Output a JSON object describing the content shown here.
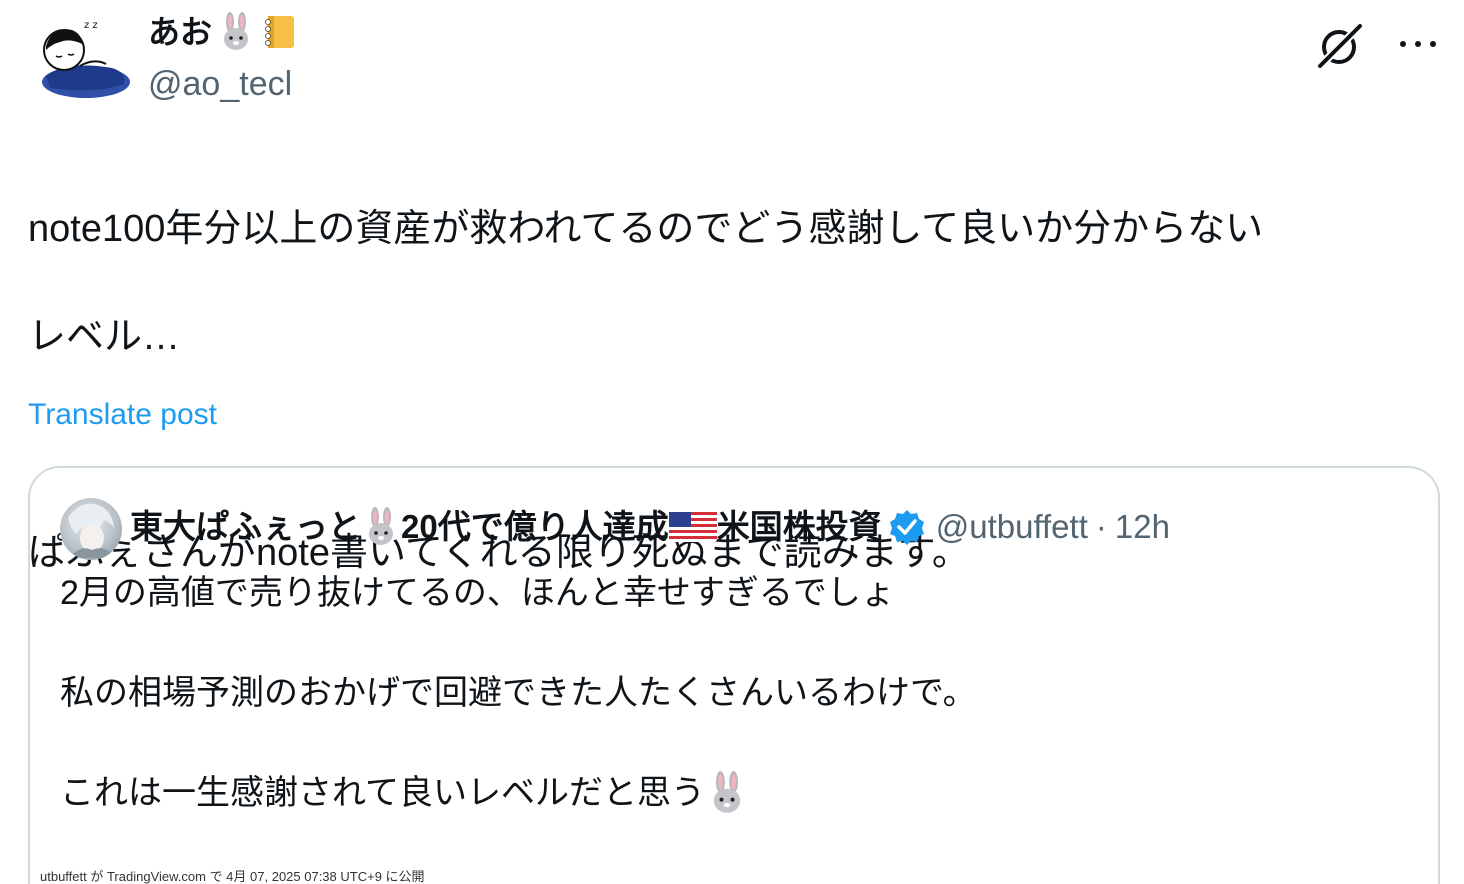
{
  "author": {
    "name": "あお",
    "name_emojis": [
      "rabbit-emoji",
      "notebook-emoji"
    ],
    "handle": "@ao_tecl"
  },
  "header_actions": {
    "grok_icon": "grok-slash-icon",
    "more_icon": "more-horizontal-icon"
  },
  "post": {
    "text_line1": "note100年分以上の資産が救われてるのでどう感謝して良いか分からない",
    "text_line2": "レベル…",
    "text_line3": "ぱふぇさんがnote書いてくれる限り死ぬまで読みます。",
    "translate_label": "Translate post"
  },
  "quote": {
    "name_part1": "東大ぱふぇっと",
    "name_part2": "20代で億り人達成",
    "name_part3": "米国株投資",
    "handle": "@utbuffett",
    "dot": "·",
    "time": "12h",
    "line1": "2月の高値で売り抜けてるの、ほんと幸せすぎるでしょ",
    "line2": "私の相場予測のおかげで回避できた人たくさんいるわけで。",
    "line3": "これは一生感謝されて良いレベルだと思う",
    "image_caption": "utbuffett が TradingView.com で 4月 07, 2025 07:38 UTC+9 に公開"
  },
  "colors": {
    "link": "#1d9bf0",
    "secondary_text": "#536471",
    "border": "#cfd9de",
    "verified": "#1d9bf0"
  }
}
